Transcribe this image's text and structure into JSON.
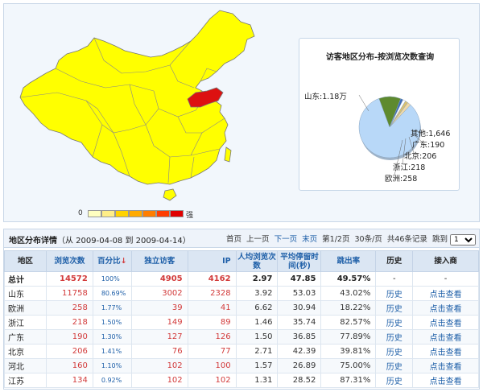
{
  "legend": {
    "min_label": "0",
    "max_label": "强",
    "colors": [
      "#ffffc0",
      "#ffee88",
      "#ffd300",
      "#ffaa00",
      "#ff7e00",
      "#ff3d00",
      "#e00000"
    ]
  },
  "map": {
    "default_color": "#ffff00",
    "highlight_region": "山东",
    "highlight_color": "#dd1111"
  },
  "pie": {
    "title": "访客地区分布-按浏览次数查询",
    "slices": [
      {
        "label": "山东:1.18万",
        "value": 11758,
        "color": "#b8d8f8"
      },
      {
        "label": "其他:1,646",
        "value": 1646,
        "color": "#5e8a2e"
      },
      {
        "label": "广东:190",
        "value": 190,
        "color": "#3b6ab6"
      },
      {
        "label": "北京:206",
        "value": 206,
        "color": "#ffffff"
      },
      {
        "label": "浙江:218",
        "value": 218,
        "color": "#d8c070"
      },
      {
        "label": "欧洲:258",
        "value": 258,
        "color": "#f0d9a6"
      }
    ]
  },
  "detail": {
    "title_bold": "地区分布详情",
    "title_range": "（从  2009-04-08 到  2009-04-14）",
    "pager": {
      "first": "首页",
      "prev": "上一页",
      "next": "下一页",
      "last": "末页",
      "page_info": "第1/2页",
      "per_page": "30条/页",
      "total": "共46条记录",
      "jump": "跳到",
      "jump_value": "1"
    },
    "columns": [
      "地区",
      "浏览次数",
      "百分比",
      "独立访客",
      "IP",
      "人均浏览次数",
      "平均停留时间(秒)",
      "跳出率",
      "历史",
      "接入商"
    ],
    "rows": [
      {
        "region": "总计",
        "pv": "14572",
        "pct": "100%",
        "visitors": "4905",
        "ip": "4162",
        "avg_pv": "2.97",
        "avg_time": "47.85",
        "bounce": "49.57%",
        "history": "-",
        "isp": "-"
      },
      {
        "region": "山东",
        "pv": "11758",
        "pct": "80.69%",
        "visitors": "3002",
        "ip": "2328",
        "avg_pv": "3.92",
        "avg_time": "53.03",
        "bounce": "43.02%",
        "history": "历史",
        "isp": "点击查看"
      },
      {
        "region": "欧洲",
        "pv": "258",
        "pct": "1.77%",
        "visitors": "39",
        "ip": "41",
        "avg_pv": "6.62",
        "avg_time": "30.94",
        "bounce": "18.22%",
        "history": "历史",
        "isp": "点击查看"
      },
      {
        "region": "浙江",
        "pv": "218",
        "pct": "1.50%",
        "visitors": "149",
        "ip": "89",
        "avg_pv": "1.46",
        "avg_time": "35.74",
        "bounce": "82.57%",
        "history": "历史",
        "isp": "点击查看"
      },
      {
        "region": "广东",
        "pv": "190",
        "pct": "1.30%",
        "visitors": "127",
        "ip": "126",
        "avg_pv": "1.50",
        "avg_time": "36.85",
        "bounce": "77.89%",
        "history": "历史",
        "isp": "点击查看"
      },
      {
        "region": "北京",
        "pv": "206",
        "pct": "1.41%",
        "visitors": "76",
        "ip": "77",
        "avg_pv": "2.71",
        "avg_time": "42.39",
        "bounce": "39.81%",
        "history": "历史",
        "isp": "点击查看"
      },
      {
        "region": "河北",
        "pv": "160",
        "pct": "1.10%",
        "visitors": "102",
        "ip": "100",
        "avg_pv": "1.57",
        "avg_time": "26.89",
        "bounce": "75.00%",
        "history": "历史",
        "isp": "点击查看"
      },
      {
        "region": "江苏",
        "pv": "134",
        "pct": "0.92%",
        "visitors": "102",
        "ip": "102",
        "avg_pv": "1.31",
        "avg_time": "28.52",
        "bounce": "87.31%",
        "history": "历史",
        "isp": "点击查看"
      }
    ]
  }
}
